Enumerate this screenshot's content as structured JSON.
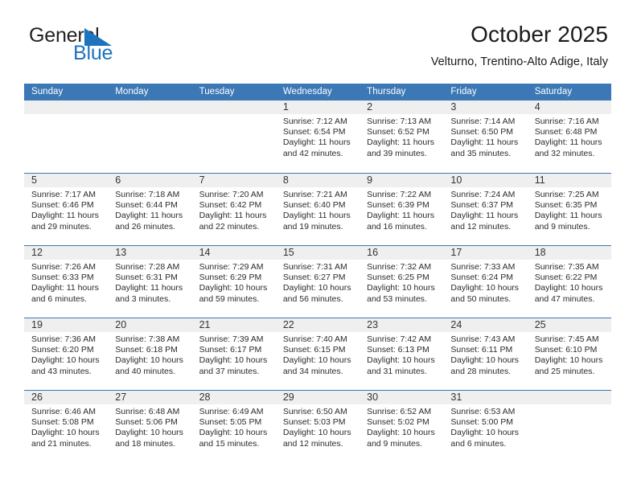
{
  "logo": {
    "word_top": "General",
    "word_bottom": "Blue",
    "triangle_color": "#1e73be"
  },
  "header": {
    "title": "October 2025",
    "subtitle": "Velturno, Trentino-Alto Adige, Italy"
  },
  "colors": {
    "header_blue": "#3b78b5",
    "day_band_gray": "#efefef",
    "text": "#222222"
  },
  "weekdays": [
    "Sunday",
    "Monday",
    "Tuesday",
    "Wednesday",
    "Thursday",
    "Friday",
    "Saturday"
  ],
  "weeks": [
    [
      {
        "day": "",
        "empty": true
      },
      {
        "day": "",
        "empty": true
      },
      {
        "day": "",
        "empty": true
      },
      {
        "day": "1",
        "sunrise": "Sunrise: 7:12 AM",
        "sunset": "Sunset: 6:54 PM",
        "daylight": "Daylight: 11 hours and 42 minutes."
      },
      {
        "day": "2",
        "sunrise": "Sunrise: 7:13 AM",
        "sunset": "Sunset: 6:52 PM",
        "daylight": "Daylight: 11 hours and 39 minutes."
      },
      {
        "day": "3",
        "sunrise": "Sunrise: 7:14 AM",
        "sunset": "Sunset: 6:50 PM",
        "daylight": "Daylight: 11 hours and 35 minutes."
      },
      {
        "day": "4",
        "sunrise": "Sunrise: 7:16 AM",
        "sunset": "Sunset: 6:48 PM",
        "daylight": "Daylight: 11 hours and 32 minutes."
      }
    ],
    [
      {
        "day": "5",
        "sunrise": "Sunrise: 7:17 AM",
        "sunset": "Sunset: 6:46 PM",
        "daylight": "Daylight: 11 hours and 29 minutes."
      },
      {
        "day": "6",
        "sunrise": "Sunrise: 7:18 AM",
        "sunset": "Sunset: 6:44 PM",
        "daylight": "Daylight: 11 hours and 26 minutes."
      },
      {
        "day": "7",
        "sunrise": "Sunrise: 7:20 AM",
        "sunset": "Sunset: 6:42 PM",
        "daylight": "Daylight: 11 hours and 22 minutes."
      },
      {
        "day": "8",
        "sunrise": "Sunrise: 7:21 AM",
        "sunset": "Sunset: 6:40 PM",
        "daylight": "Daylight: 11 hours and 19 minutes."
      },
      {
        "day": "9",
        "sunrise": "Sunrise: 7:22 AM",
        "sunset": "Sunset: 6:39 PM",
        "daylight": "Daylight: 11 hours and 16 minutes."
      },
      {
        "day": "10",
        "sunrise": "Sunrise: 7:24 AM",
        "sunset": "Sunset: 6:37 PM",
        "daylight": "Daylight: 11 hours and 12 minutes."
      },
      {
        "day": "11",
        "sunrise": "Sunrise: 7:25 AM",
        "sunset": "Sunset: 6:35 PM",
        "daylight": "Daylight: 11 hours and 9 minutes."
      }
    ],
    [
      {
        "day": "12",
        "sunrise": "Sunrise: 7:26 AM",
        "sunset": "Sunset: 6:33 PM",
        "daylight": "Daylight: 11 hours and 6 minutes."
      },
      {
        "day": "13",
        "sunrise": "Sunrise: 7:28 AM",
        "sunset": "Sunset: 6:31 PM",
        "daylight": "Daylight: 11 hours and 3 minutes."
      },
      {
        "day": "14",
        "sunrise": "Sunrise: 7:29 AM",
        "sunset": "Sunset: 6:29 PM",
        "daylight": "Daylight: 10 hours and 59 minutes."
      },
      {
        "day": "15",
        "sunrise": "Sunrise: 7:31 AM",
        "sunset": "Sunset: 6:27 PM",
        "daylight": "Daylight: 10 hours and 56 minutes."
      },
      {
        "day": "16",
        "sunrise": "Sunrise: 7:32 AM",
        "sunset": "Sunset: 6:25 PM",
        "daylight": "Daylight: 10 hours and 53 minutes."
      },
      {
        "day": "17",
        "sunrise": "Sunrise: 7:33 AM",
        "sunset": "Sunset: 6:24 PM",
        "daylight": "Daylight: 10 hours and 50 minutes."
      },
      {
        "day": "18",
        "sunrise": "Sunrise: 7:35 AM",
        "sunset": "Sunset: 6:22 PM",
        "daylight": "Daylight: 10 hours and 47 minutes."
      }
    ],
    [
      {
        "day": "19",
        "sunrise": "Sunrise: 7:36 AM",
        "sunset": "Sunset: 6:20 PM",
        "daylight": "Daylight: 10 hours and 43 minutes."
      },
      {
        "day": "20",
        "sunrise": "Sunrise: 7:38 AM",
        "sunset": "Sunset: 6:18 PM",
        "daylight": "Daylight: 10 hours and 40 minutes."
      },
      {
        "day": "21",
        "sunrise": "Sunrise: 7:39 AM",
        "sunset": "Sunset: 6:17 PM",
        "daylight": "Daylight: 10 hours and 37 minutes."
      },
      {
        "day": "22",
        "sunrise": "Sunrise: 7:40 AM",
        "sunset": "Sunset: 6:15 PM",
        "daylight": "Daylight: 10 hours and 34 minutes."
      },
      {
        "day": "23",
        "sunrise": "Sunrise: 7:42 AM",
        "sunset": "Sunset: 6:13 PM",
        "daylight": "Daylight: 10 hours and 31 minutes."
      },
      {
        "day": "24",
        "sunrise": "Sunrise: 7:43 AM",
        "sunset": "Sunset: 6:11 PM",
        "daylight": "Daylight: 10 hours and 28 minutes."
      },
      {
        "day": "25",
        "sunrise": "Sunrise: 7:45 AM",
        "sunset": "Sunset: 6:10 PM",
        "daylight": "Daylight: 10 hours and 25 minutes."
      }
    ],
    [
      {
        "day": "26",
        "sunrise": "Sunrise: 6:46 AM",
        "sunset": "Sunset: 5:08 PM",
        "daylight": "Daylight: 10 hours and 21 minutes."
      },
      {
        "day": "27",
        "sunrise": "Sunrise: 6:48 AM",
        "sunset": "Sunset: 5:06 PM",
        "daylight": "Daylight: 10 hours and 18 minutes."
      },
      {
        "day": "28",
        "sunrise": "Sunrise: 6:49 AM",
        "sunset": "Sunset: 5:05 PM",
        "daylight": "Daylight: 10 hours and 15 minutes."
      },
      {
        "day": "29",
        "sunrise": "Sunrise: 6:50 AM",
        "sunset": "Sunset: 5:03 PM",
        "daylight": "Daylight: 10 hours and 12 minutes."
      },
      {
        "day": "30",
        "sunrise": "Sunrise: 6:52 AM",
        "sunset": "Sunset: 5:02 PM",
        "daylight": "Daylight: 10 hours and 9 minutes."
      },
      {
        "day": "31",
        "sunrise": "Sunrise: 6:53 AM",
        "sunset": "Sunset: 5:00 PM",
        "daylight": "Daylight: 10 hours and 6 minutes."
      },
      {
        "day": "",
        "empty": true
      }
    ]
  ]
}
